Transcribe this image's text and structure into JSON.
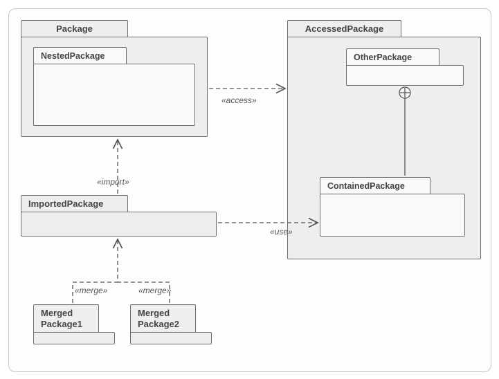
{
  "packages": {
    "package": "Package",
    "nested": "NestedPackage",
    "accessed": "AccessedPackage",
    "other": "OtherPackage",
    "contained": "ContainedPackage",
    "imported": "ImportedPackage",
    "merged1": "Merged\nPackage1",
    "merged2": "Merged\nPackage2"
  },
  "labels": {
    "access": "«access»",
    "import": "«import»",
    "use": "«use»",
    "merge1": "«merge»",
    "merge2": "«merge»"
  }
}
